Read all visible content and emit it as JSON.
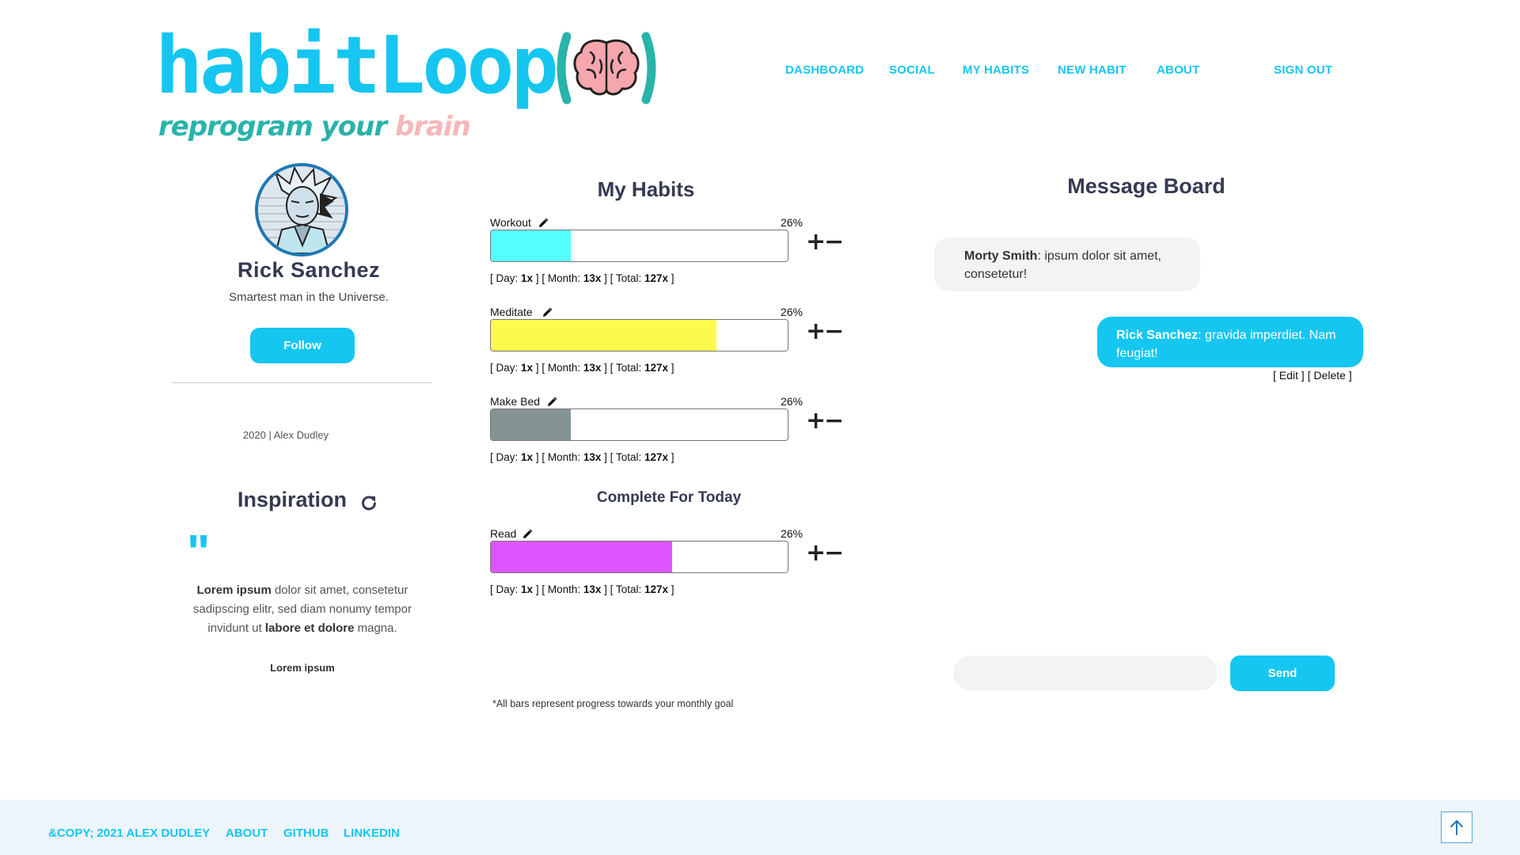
{
  "brand": {
    "title": "habitLoop",
    "tagline_main": "reprogram your",
    "tagline_accent": "brain",
    "colors": {
      "primary": "#15c6f0",
      "teal": "#2ab3ab",
      "pink": "#f6b7b7"
    }
  },
  "nav": {
    "items": [
      "DASHBOARD",
      "SOCIAL",
      "MY HABITS",
      "NEW HABIT",
      "ABOUT"
    ],
    "signout": "SIGN OUT"
  },
  "profile": {
    "name": "Rick Sanchez",
    "bio": "Smartest man in the Universe.",
    "follow_label": "Follow",
    "meta": "2020 | Alex Dudley"
  },
  "inspiration": {
    "title": "Inspiration",
    "quote_mark": "\"",
    "quote_b1": "Lorem ipsum",
    "quote_t1": " dolor sit amet, consetetur sadipscing elitr, sed diam nonumy tempor invidunt ut ",
    "quote_b2": "labore et dolore",
    "quote_t2": " magna.",
    "author": "Lorem ipsum"
  },
  "habits": {
    "title": "My Habits",
    "complete_title": "Complete For Today",
    "footnote": "*All bars represent progress towards your monthly goal",
    "stat_labels": {
      "day": "Day:",
      "month": "Month:",
      "total": "Total:"
    },
    "active": [
      {
        "name": "Workout",
        "pct": "26%",
        "progress": 0.27,
        "color": "#55ffff",
        "day": "1x",
        "month": "13x",
        "total": "127x"
      },
      {
        "name": "Meditate",
        "pct": "26%",
        "progress": 0.76,
        "color": "#fdfa4e",
        "day": "1x",
        "month": "13x",
        "total": "127x"
      },
      {
        "name": "Make Bed",
        "pct": "26%",
        "progress": 0.27,
        "color": "#869393",
        "day": "1x",
        "month": "13x",
        "total": "127x"
      }
    ],
    "complete": [
      {
        "name": "Read",
        "pct": "26%",
        "progress": 0.61,
        "color": "#dd55ff",
        "day": "1x",
        "month": "13x",
        "total": "127x"
      }
    ]
  },
  "message_board": {
    "title": "Message Board",
    "messages": [
      {
        "author": "Morty Smith",
        "text": ": ipsum dolor sit amet, consetetur!"
      },
      {
        "author": "Rick Sanchez",
        "text": ": gravida imperdiet. Nam feugiat!"
      }
    ],
    "actions": {
      "edit": "[ Edit ]",
      "delete": "[ Delete ]"
    },
    "input_placeholder": "",
    "send_label": "Send"
  },
  "footer": {
    "copyright": "&COPY; 2021 ALEX DUDLEY",
    "links": [
      "ABOUT",
      "GITHUB",
      "LINKEDIN"
    ]
  }
}
